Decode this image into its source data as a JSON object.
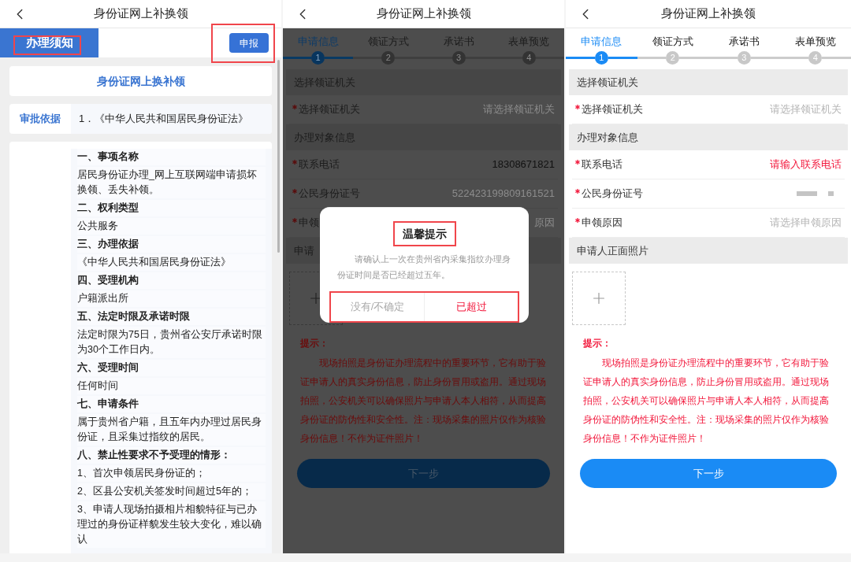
{
  "panels": [
    {
      "kind": "notice",
      "title": "身份证网上补换领",
      "tabs": [
        {
          "label": "办理须知",
          "selected": true
        }
      ],
      "action_button": "申报",
      "card_title": "身份证网上换补领",
      "basis": {
        "label": "审批依据",
        "value": "1．《中华人民共和国居民身份证法》"
      },
      "sections": [
        {
          "kind": "heading",
          "text": "一、事项名称"
        },
        {
          "kind": "text",
          "text": "居民身份证办理_网上互联网端申请损坏换领、丢失补领。"
        },
        {
          "kind": "heading",
          "text": "二、权利类型"
        },
        {
          "kind": "text",
          "text": "公共服务"
        },
        {
          "kind": "heading",
          "text": "三、办理依据"
        },
        {
          "kind": "text",
          "text": "《中华人民共和国居民身份证法》"
        },
        {
          "kind": "heading",
          "text": "四、受理机构"
        },
        {
          "kind": "text",
          "text": "户籍派出所"
        },
        {
          "kind": "heading",
          "text": "五、法定时限及承诺时限"
        },
        {
          "kind": "text",
          "text": "法定时限为75日，贵州省公安厅承诺时限为30个工作日内。"
        },
        {
          "kind": "heading",
          "text": "六、受理时间"
        },
        {
          "kind": "text",
          "text": "任何时间"
        },
        {
          "kind": "heading",
          "text": "七、申请条件"
        },
        {
          "kind": "text",
          "text": "属于贵州省户籍，且五年内办理过居民身份证，且采集过指纹的居民。"
        },
        {
          "kind": "heading",
          "text": "八、禁止性要求不予受理的情形："
        },
        {
          "kind": "text",
          "text": "1、首次申领居民身份证的；"
        },
        {
          "kind": "text",
          "text": "2、区县公安机关签发时间超过5年的；"
        },
        {
          "kind": "text",
          "text": "3、申请人现场拍摄相片相貌特征与已办理过的身份证样貌发生较大变化，难以确认"
        }
      ]
    },
    {
      "kind": "form",
      "dimmed": true,
      "title": "身份证网上补换领",
      "steps": [
        {
          "label": "申请信息",
          "number": "1",
          "selected": true
        },
        {
          "label": "领证方式",
          "number": "2",
          "selected": false
        },
        {
          "label": "承诺书",
          "number": "3",
          "selected": false
        },
        {
          "label": "表单预览",
          "number": "4",
          "selected": false
        }
      ],
      "rows": [
        {
          "kind": "header",
          "label": "选择领证机关"
        },
        {
          "kind": "select",
          "required": true,
          "label": "选择领证机关",
          "placeholder": "请选择领证机关"
        },
        {
          "kind": "header",
          "label": "办理对象信息"
        },
        {
          "kind": "input",
          "required": true,
          "label": "联系电话",
          "value": "18308671821"
        },
        {
          "kind": "readonly",
          "required": true,
          "label": "公民身份证号",
          "value": "522423199809161521"
        },
        {
          "kind": "select",
          "required": true,
          "label": "申领",
          "placeholder": "原因"
        },
        {
          "kind": "header",
          "label": "申请"
        }
      ],
      "tip_title": "提示：",
      "tip_text": "现场拍照是身份证办理流程中的重要环节，它有助于验证申请人的真实身份信息，防止身份冒用或盗用。通过现场拍照，公安机关可以确保照片与申请人本人相符，从而提高身份证的防伪性和安全性。注：现场采集的照片仅作为核验身份信息！不作为证件照片！",
      "next_button": "下一步",
      "dialog": {
        "title": "温馨提示",
        "message": "请确认上一次在贵州省内采集指纹办理身份证时间是否已经超过五年。",
        "buttons": [
          {
            "label": "没有/不确定",
            "kind": "cancel"
          },
          {
            "label": "已超过",
            "kind": "confirm"
          }
        ]
      }
    },
    {
      "kind": "form",
      "dimmed": false,
      "title": "身份证网上补换领",
      "steps": [
        {
          "label": "申请信息",
          "number": "1",
          "selected": true
        },
        {
          "label": "领证方式",
          "number": "2",
          "selected": false
        },
        {
          "label": "承诺书",
          "number": "3",
          "selected": false
        },
        {
          "label": "表单预览",
          "number": "4",
          "selected": false
        }
      ],
      "rows": [
        {
          "kind": "header",
          "label": "选择领证机关"
        },
        {
          "kind": "select",
          "required": true,
          "label": "选择领证机关",
          "placeholder": "请选择领证机关"
        },
        {
          "kind": "header",
          "label": "办理对象信息"
        },
        {
          "kind": "error",
          "required": true,
          "label": "联系电话",
          "value": "请输入联系电话"
        },
        {
          "kind": "redacted",
          "required": true,
          "label": "公民身份证号"
        },
        {
          "kind": "select",
          "required": true,
          "label": "申领原因",
          "placeholder": "请选择申领原因"
        },
        {
          "kind": "header",
          "label": "申请人正面照片"
        }
      ],
      "tip_title": "提示：",
      "tip_text": "现场拍照是身份证办理流程中的重要环节，它有助于验证申请人的真实身份信息，防止身份冒用或盗用。通过现场拍照，公安机关可以确保照片与申请人本人相符，从而提高身份证的防伪性和安全性。注：现场采集的照片仅作为核验身份信息！不作为证件照片！",
      "next_button": "下一步"
    }
  ]
}
